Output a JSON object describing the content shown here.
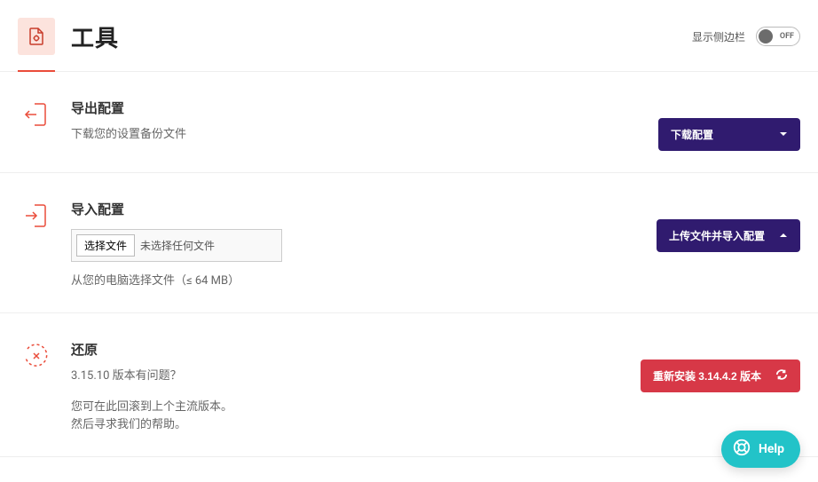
{
  "header": {
    "title": "工具",
    "sidebar_label": "显示侧边栏",
    "toggle_state": "OFF"
  },
  "sections": {
    "export": {
      "title": "导出配置",
      "desc": "下载您的设置备份文件",
      "button_label": "下载配置"
    },
    "import": {
      "title": "导入配置",
      "file_button": "选择文件",
      "file_status": "未选择任何文件",
      "hint": "从您的电脑选择文件（≤ 64 MB）",
      "button_label": "上传文件并导入配置"
    },
    "restore": {
      "title": "还原",
      "line1": "3.15.10 版本有问题？",
      "line2": "您可在此回滚到上个主流版本。",
      "line3": "然后寻求我们的帮助。",
      "button_label": "重新安装 3.14.4.2 版本"
    }
  },
  "help": {
    "label": "Help"
  }
}
